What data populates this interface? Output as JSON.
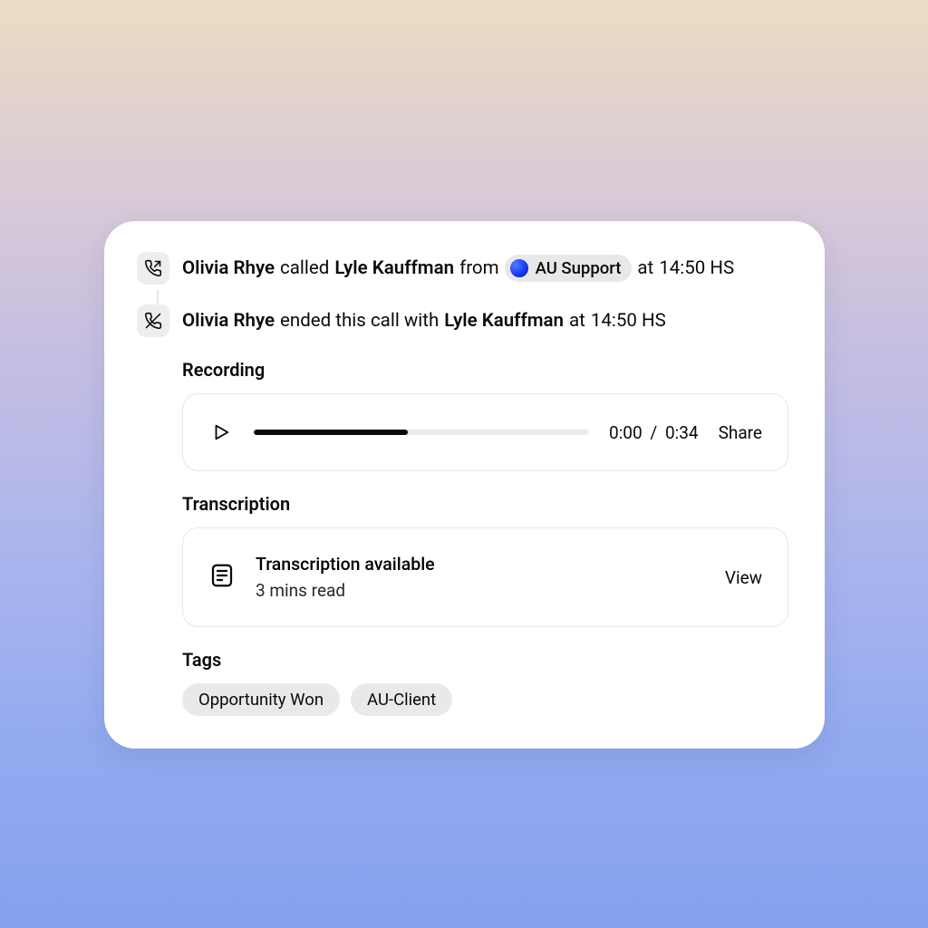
{
  "events": [
    {
      "caller": "Olivia Rhye",
      "verb": "called",
      "callee": "Lyle Kauffman",
      "from_word": "from",
      "team": "AU Support",
      "at_word": "at",
      "time": "14:50 HS"
    },
    {
      "caller": "Olivia Rhye",
      "verb": "ended this call with",
      "callee": "Lyle Kauffman",
      "at_word": "at",
      "time": "14:50 HS"
    }
  ],
  "recording": {
    "label": "Recording",
    "current": "0:00",
    "separator": "/",
    "duration": "0:34",
    "share_label": "Share"
  },
  "transcription": {
    "label": "Transcription",
    "title": "Transcription available",
    "subtitle": "3 mins read",
    "view_label": "View"
  },
  "tags": {
    "label": "Tags",
    "items": [
      "Opportunity Won",
      "AU-Client"
    ]
  }
}
